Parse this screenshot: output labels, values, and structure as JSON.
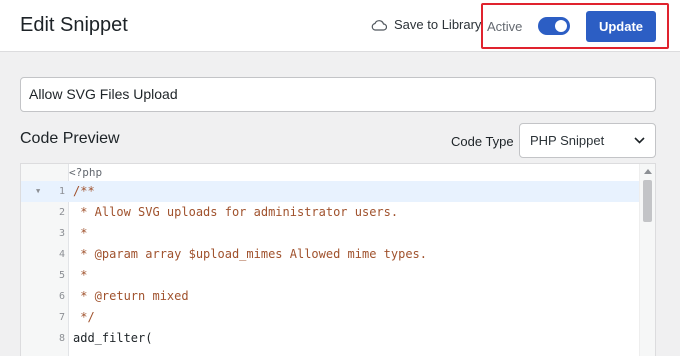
{
  "header": {
    "title": "Edit Snippet",
    "save_to_library": "Save to Library",
    "save_icon": "cloud-icon",
    "active_label": "Active",
    "active_state": true,
    "update_label": "Update",
    "accent_color": "#2c5ec4",
    "highlight_color": "#e0232e"
  },
  "snippet": {
    "title": "Allow SVG Files Upload"
  },
  "code_preview": {
    "section_title": "Code Preview",
    "code_type_label": "Code Type",
    "code_type_value": "PHP Snippet",
    "php_open_tag": "<?php",
    "lines": [
      {
        "no": "1",
        "text": "/**"
      },
      {
        "no": "2",
        "text": " * Allow SVG uploads for administrator users."
      },
      {
        "no": "3",
        "text": " *"
      },
      {
        "no": "4",
        "text": " * @param array $upload_mimes Allowed mime types."
      },
      {
        "no": "5",
        "text": " *"
      },
      {
        "no": "6",
        "text": " * @return mixed"
      },
      {
        "no": "7",
        "text": " */"
      },
      {
        "no": "8",
        "text": "add_filter("
      }
    ]
  }
}
